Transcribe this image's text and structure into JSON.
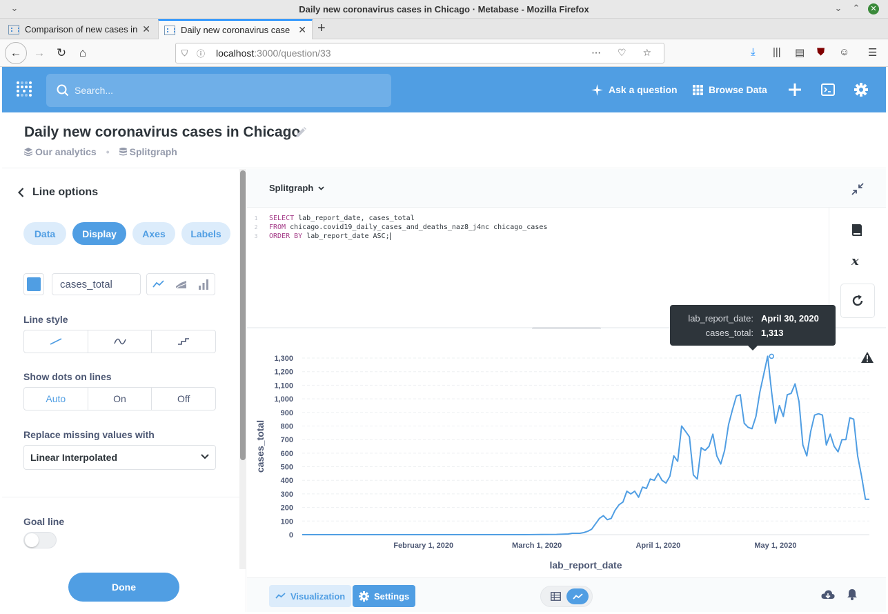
{
  "window": {
    "title": "Daily new coronavirus cases in Chicago · Metabase - Mozilla Firefox"
  },
  "tabs": [
    {
      "label": "Comparison of new cases in",
      "active": false
    },
    {
      "label": "Daily new coronavirus case",
      "active": true
    }
  ],
  "browser": {
    "url_host": "localhost",
    "url_rest": ":3000/question/33"
  },
  "nav": {
    "search_placeholder": "Search...",
    "ask_question": "Ask a question",
    "browse_data": "Browse Data"
  },
  "question": {
    "title": "Daily new coronavirus cases in Chicago",
    "collection": "Our analytics",
    "database": "Splitgraph"
  },
  "sidebar": {
    "back_label": "Line options",
    "tabs": [
      "Data",
      "Display",
      "Axes",
      "Labels"
    ],
    "active_tab": "Display",
    "series_name": "cases_total",
    "series_color": "#509ee3",
    "line_style_label": "Line style",
    "show_dots_label": "Show dots on lines",
    "show_dots_options": [
      "Auto",
      "On",
      "Off"
    ],
    "show_dots_selected": "Auto",
    "replace_missing_label": "Replace missing values with",
    "replace_missing_value": "Linear Interpolated",
    "goal_line_label": "Goal line",
    "goal_line_enabled": false,
    "done_label": "Done"
  },
  "editor": {
    "database": "Splitgraph",
    "lines": [
      {
        "num": "1",
        "kw": "SELECT",
        "rest": " lab_report_date, cases_total"
      },
      {
        "num": "2",
        "kw": "FROM",
        "rest": " chicago.covid19_daily_cases_and_deaths_naz8_j4nc chicago_cases"
      },
      {
        "num": "3",
        "kw": "ORDER BY",
        "rest": " lab_report_date ASC;"
      }
    ]
  },
  "tooltip": {
    "key1": "lab_report_date:",
    "val1": "April 30, 2020",
    "key2": "cases_total:",
    "val2": "1,313"
  },
  "footer": {
    "visualization_label": "Visualization",
    "settings_label": "Settings"
  },
  "colors": {
    "brand": "#509ee3",
    "line": "#509ee3",
    "text_dark": "#2e353b",
    "text_medium": "#4c5773"
  },
  "chart_data": {
    "type": "line",
    "xlabel": "lab_report_date",
    "ylabel": "cases_total",
    "ylim": [
      0,
      1300
    ],
    "yticks": [
      0,
      100,
      200,
      300,
      400,
      500,
      600,
      700,
      800,
      900,
      1000,
      1100,
      1200,
      1300
    ],
    "ytick_labels": [
      "0",
      "100",
      "200",
      "300",
      "400",
      "500",
      "600",
      "700",
      "800",
      "900",
      "1,000",
      "1,100",
      "1,200",
      "1,300"
    ],
    "xticks": [
      "2020-02-01",
      "2020-03-01",
      "2020-04-01",
      "2020-05-01"
    ],
    "xtick_labels": [
      "February 1, 2020",
      "March 1, 2020",
      "April 1, 2020",
      "May 1, 2020"
    ],
    "x_start": "2020-01-01",
    "x_end": "2020-05-25",
    "grid": true,
    "highlight": {
      "x": "2020-04-30",
      "y": 1313
    },
    "series": [
      {
        "name": "cases_total",
        "x": [
          "2020-01-01",
          "2020-01-08",
          "2020-01-15",
          "2020-01-22",
          "2020-01-29",
          "2020-02-05",
          "2020-02-12",
          "2020-02-19",
          "2020-02-26",
          "2020-03-02",
          "2020-03-06",
          "2020-03-09",
          "2020-03-10",
          "2020-03-11",
          "2020-03-12",
          "2020-03-13",
          "2020-03-14",
          "2020-03-15",
          "2020-03-16",
          "2020-03-17",
          "2020-03-18",
          "2020-03-19",
          "2020-03-20",
          "2020-03-21",
          "2020-03-22",
          "2020-03-23",
          "2020-03-24",
          "2020-03-25",
          "2020-03-26",
          "2020-03-27",
          "2020-03-28",
          "2020-03-29",
          "2020-03-30",
          "2020-03-31",
          "2020-04-01",
          "2020-04-02",
          "2020-04-03",
          "2020-04-04",
          "2020-04-05",
          "2020-04-06",
          "2020-04-07",
          "2020-04-08",
          "2020-04-09",
          "2020-04-10",
          "2020-04-11",
          "2020-04-12",
          "2020-04-13",
          "2020-04-14",
          "2020-04-15",
          "2020-04-16",
          "2020-04-17",
          "2020-04-18",
          "2020-04-19",
          "2020-04-20",
          "2020-04-21",
          "2020-04-22",
          "2020-04-23",
          "2020-04-24",
          "2020-04-25",
          "2020-04-26",
          "2020-04-27",
          "2020-04-28",
          "2020-04-29",
          "2020-04-30",
          "2020-05-01",
          "2020-05-02",
          "2020-05-03",
          "2020-05-04",
          "2020-05-05",
          "2020-05-06",
          "2020-05-07",
          "2020-05-08",
          "2020-05-09",
          "2020-05-10",
          "2020-05-11",
          "2020-05-12",
          "2020-05-13",
          "2020-05-14",
          "2020-05-15",
          "2020-05-16",
          "2020-05-17",
          "2020-05-18",
          "2020-05-19",
          "2020-05-20",
          "2020-05-21",
          "2020-05-22",
          "2020-05-23",
          "2020-05-24",
          "2020-05-25"
        ],
        "values": [
          0,
          0,
          0,
          0,
          0,
          0,
          0,
          0,
          0,
          1,
          2,
          5,
          10,
          10,
          10,
          15,
          25,
          40,
          80,
          120,
          140,
          110,
          120,
          180,
          220,
          240,
          320,
          300,
          320,
          275,
          350,
          340,
          410,
          400,
          450,
          400,
          380,
          430,
          580,
          540,
          800,
          760,
          720,
          440,
          410,
          640,
          620,
          650,
          740,
          580,
          520,
          620,
          810,
          920,
          1020,
          1030,
          820,
          790,
          780,
          870,
          1050,
          1180,
          1313,
          1050,
          820,
          950,
          870,
          1030,
          1040,
          1110,
          980,
          660,
          580,
          760,
          880,
          890,
          880,
          660,
          740,
          650,
          610,
          700,
          700,
          860,
          850,
          580,
          430,
          260,
          260
        ]
      }
    ]
  }
}
